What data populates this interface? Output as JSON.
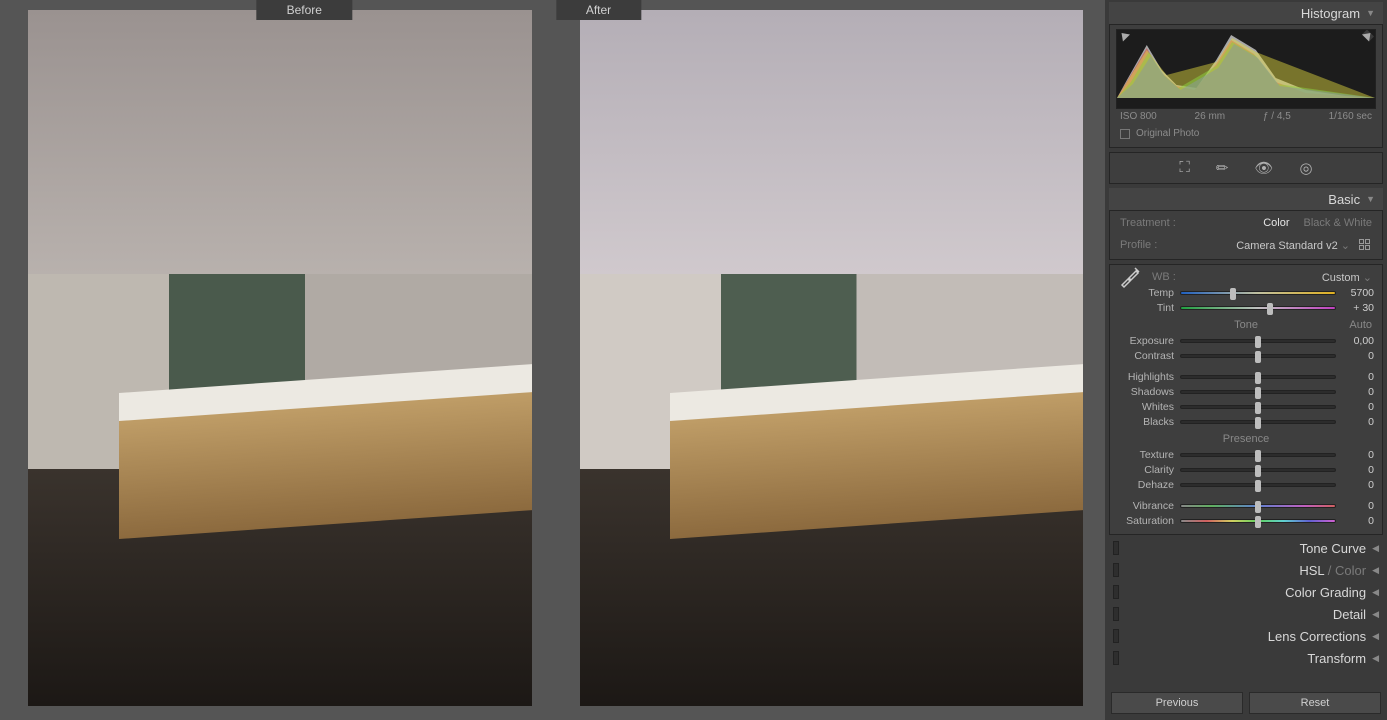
{
  "compare": {
    "before_label": "Before",
    "after_label": "After"
  },
  "histogram_panel": {
    "title": "Histogram",
    "exif": {
      "iso": "ISO 800",
      "focal": "26 mm",
      "aperture": "ƒ / 4,5",
      "shutter": "1/160 sec"
    },
    "original_photo_label": "Original Photo"
  },
  "tool_icons": [
    "crop-icon",
    "brush-icon",
    "eye-icon",
    "radial-icon"
  ],
  "basic": {
    "title": "Basic",
    "treatment_label": "Treatment :",
    "treatment_color": "Color",
    "treatment_bw": "Black & White",
    "profile_label": "Profile :",
    "profile_value": "Camera Standard v2",
    "wb_label": "WB :",
    "wb_value": "Custom",
    "sliders": {
      "temp": {
        "label": "Temp",
        "value": "5700",
        "pos": 34
      },
      "tint": {
        "label": "Tint",
        "value": "+ 30",
        "pos": 58
      },
      "exposure": {
        "label": "Exposure",
        "value": "0,00",
        "pos": 50
      },
      "contrast": {
        "label": "Contrast",
        "value": "0",
        "pos": 50
      },
      "highlights": {
        "label": "Highlights",
        "value": "0",
        "pos": 50
      },
      "shadows": {
        "label": "Shadows",
        "value": "0",
        "pos": 50
      },
      "whites": {
        "label": "Whites",
        "value": "0",
        "pos": 50
      },
      "blacks": {
        "label": "Blacks",
        "value": "0",
        "pos": 50
      },
      "texture": {
        "label": "Texture",
        "value": "0",
        "pos": 50
      },
      "clarity": {
        "label": "Clarity",
        "value": "0",
        "pos": 50
      },
      "dehaze": {
        "label": "Dehaze",
        "value": "0",
        "pos": 50
      },
      "vibrance": {
        "label": "Vibrance",
        "value": "0",
        "pos": 50
      },
      "saturation": {
        "label": "Saturation",
        "value": "0",
        "pos": 50
      }
    },
    "tone_label": "Tone",
    "tone_auto": "Auto",
    "presence_label": "Presence"
  },
  "collapsed_panels": {
    "tone_curve": "Tone Curve",
    "hsl": "HSL",
    "hsl_sep": " / ",
    "hsl_color": "Color",
    "color_grading": "Color Grading",
    "detail": "Detail",
    "lens": "Lens Corrections",
    "transform": "Transform"
  },
  "buttons": {
    "previous": "Previous",
    "reset": "Reset"
  }
}
